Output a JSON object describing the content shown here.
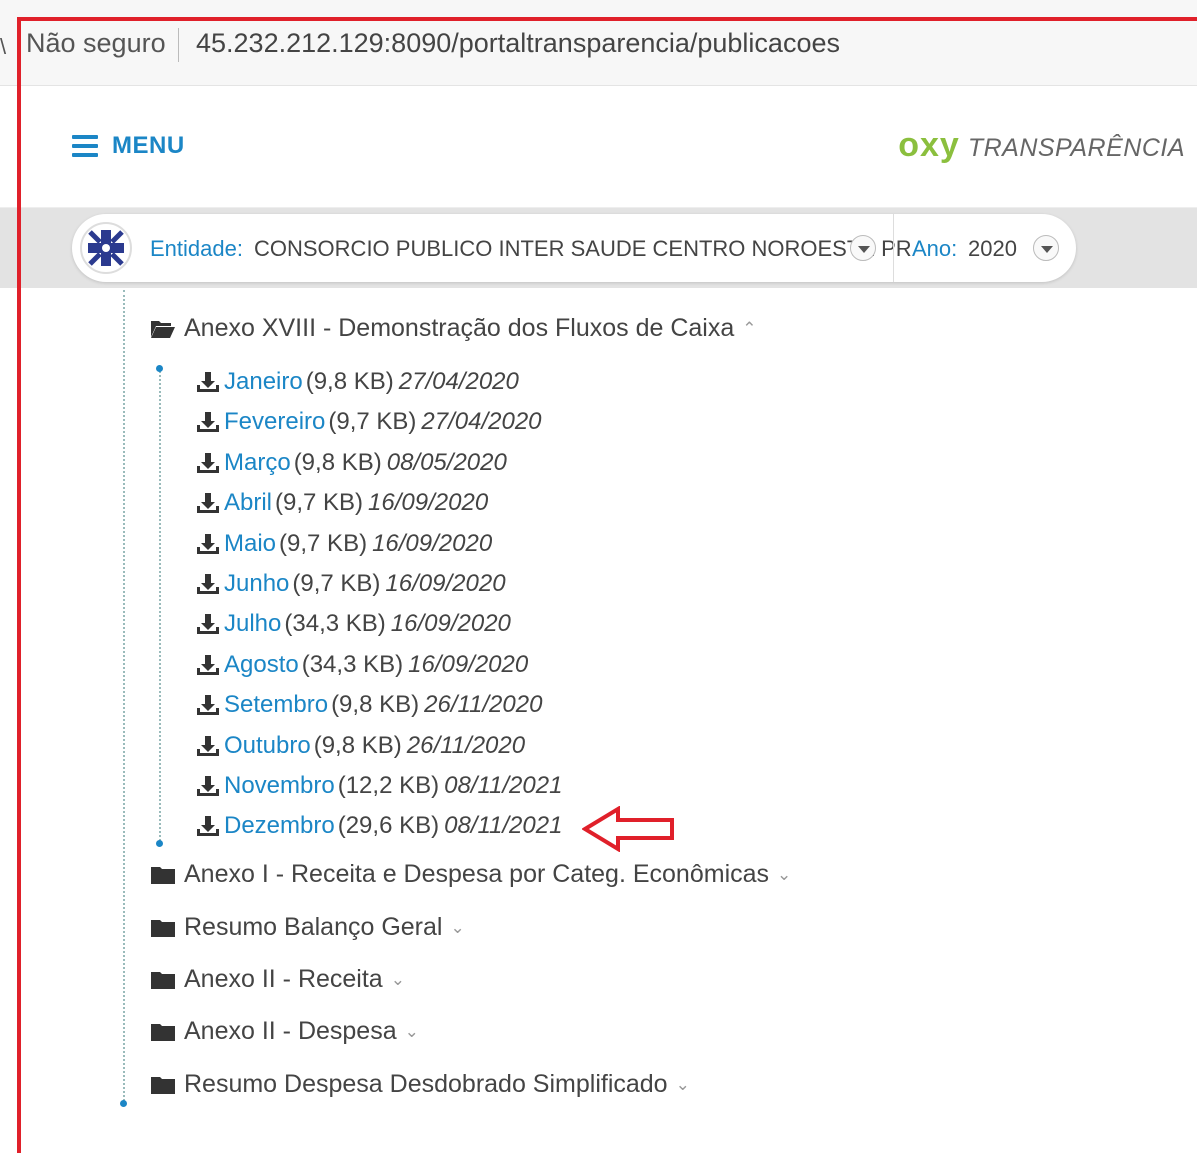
{
  "browser": {
    "lead_char": "\\",
    "security_label": "Não seguro",
    "url": "45.232.212.129:8090/portaltransparencia/publicacoes"
  },
  "header": {
    "menu_label": "MENU",
    "brand_logo": "oxy",
    "brand_text": "TRANSPARÊNCIA"
  },
  "filters": {
    "entity_label": "Entidade:",
    "entity_value": "CONSORCIO PUBLICO INTER SAUDE CENTRO NOROESTE PR",
    "year_label": "Ano:",
    "year_value": "2020"
  },
  "tree": {
    "open_folder": {
      "label": "Anexo XVIII - Demonstração dos Fluxos de Caixa",
      "files": [
        {
          "name": "Janeiro",
          "size": "(9,8 KB)",
          "date": "27/04/2020"
        },
        {
          "name": "Fevereiro",
          "size": "(9,7 KB)",
          "date": "27/04/2020"
        },
        {
          "name": "Março",
          "size": "(9,8 KB)",
          "date": "08/05/2020"
        },
        {
          "name": "Abril",
          "size": "(9,7 KB)",
          "date": "16/09/2020"
        },
        {
          "name": "Maio",
          "size": "(9,7 KB)",
          "date": "16/09/2020"
        },
        {
          "name": "Junho",
          "size": "(9,7 KB)",
          "date": "16/09/2020"
        },
        {
          "name": "Julho",
          "size": "(34,3 KB)",
          "date": "16/09/2020"
        },
        {
          "name": "Agosto",
          "size": "(34,3 KB)",
          "date": "16/09/2020"
        },
        {
          "name": "Setembro",
          "size": "(9,8 KB)",
          "date": "26/11/2020"
        },
        {
          "name": "Outubro",
          "size": "(9,8 KB)",
          "date": "26/11/2020"
        },
        {
          "name": "Novembro",
          "size": "(12,2 KB)",
          "date": "08/11/2021"
        },
        {
          "name": "Dezembro",
          "size": "(29,6 KB)",
          "date": "08/11/2021"
        }
      ]
    },
    "closed_folders": [
      {
        "label": "Anexo I - Receita e Despesa por Categ. Econômicas"
      },
      {
        "label": "Resumo Balanço Geral"
      },
      {
        "label": "Anexo II - Receita"
      },
      {
        "label": "Anexo II - Despesa"
      },
      {
        "label": "Resumo Despesa Desdobrado Simplificado"
      }
    ]
  },
  "colors": {
    "accent": "#1b86c6",
    "brand_green": "#8bbf3e",
    "annotation_red": "#e0202a"
  }
}
